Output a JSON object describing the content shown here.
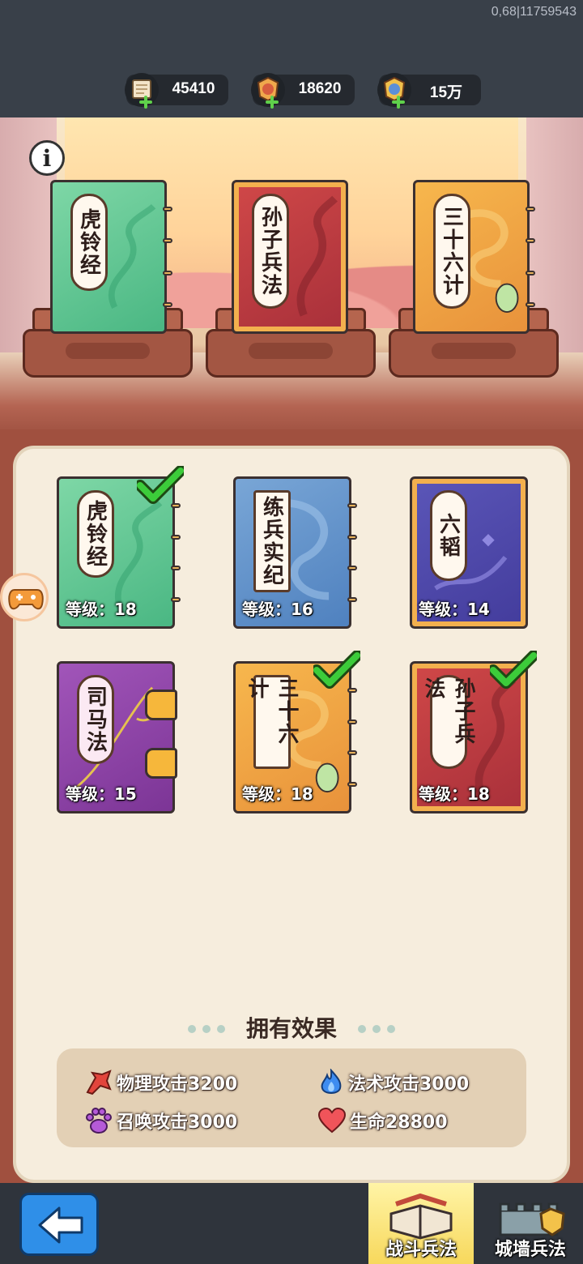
{
  "build_id": "0,68|11759543",
  "currencies": [
    {
      "name": "scroll-currency",
      "amount": "45410"
    },
    {
      "name": "medal-currency",
      "amount": "18620"
    },
    {
      "name": "badge-currency",
      "amount": "15万"
    }
  ],
  "info_button": "i",
  "equipped_books": [
    {
      "title": "虎铃经",
      "color": "#4ab783"
    },
    {
      "title": "孙子兵法",
      "color": "#a8303a"
    },
    {
      "title": "三十六计",
      "color": "#e8923b"
    }
  ],
  "books": [
    {
      "title": "虎铃经",
      "level_text": "等级：18",
      "equipped": true,
      "color": "#4ab783"
    },
    {
      "title": "练兵实纪",
      "level_text": "等级：16",
      "equipped": false,
      "color": "#4f81bf"
    },
    {
      "title": "六韬",
      "level_text": "等级：14",
      "equipped": false,
      "color": "#433c9c"
    },
    {
      "title": "司马法",
      "level_text": "等级：15",
      "equipped": false,
      "color": "#7c3596"
    },
    {
      "title": "三十六计",
      "level_text": "等级：18",
      "equipped": true,
      "color": "#e8923b"
    },
    {
      "title": "孙子兵法",
      "level_text": "等级：18",
      "equipped": true,
      "color": "#a8303a"
    }
  ],
  "effects": {
    "title": "拥有效果",
    "items": [
      {
        "icon": "physical-attack-icon",
        "text": "物理攻击3200"
      },
      {
        "icon": "magic-attack-icon",
        "text": "法术攻击3000"
      },
      {
        "icon": "summon-attack-icon",
        "text": "召唤攻击3000"
      },
      {
        "icon": "life-icon",
        "text": "生命28800"
      }
    ]
  },
  "bottom_tabs": [
    {
      "label": "战斗兵法",
      "active": true
    },
    {
      "label": "城墙兵法",
      "active": false
    }
  ]
}
